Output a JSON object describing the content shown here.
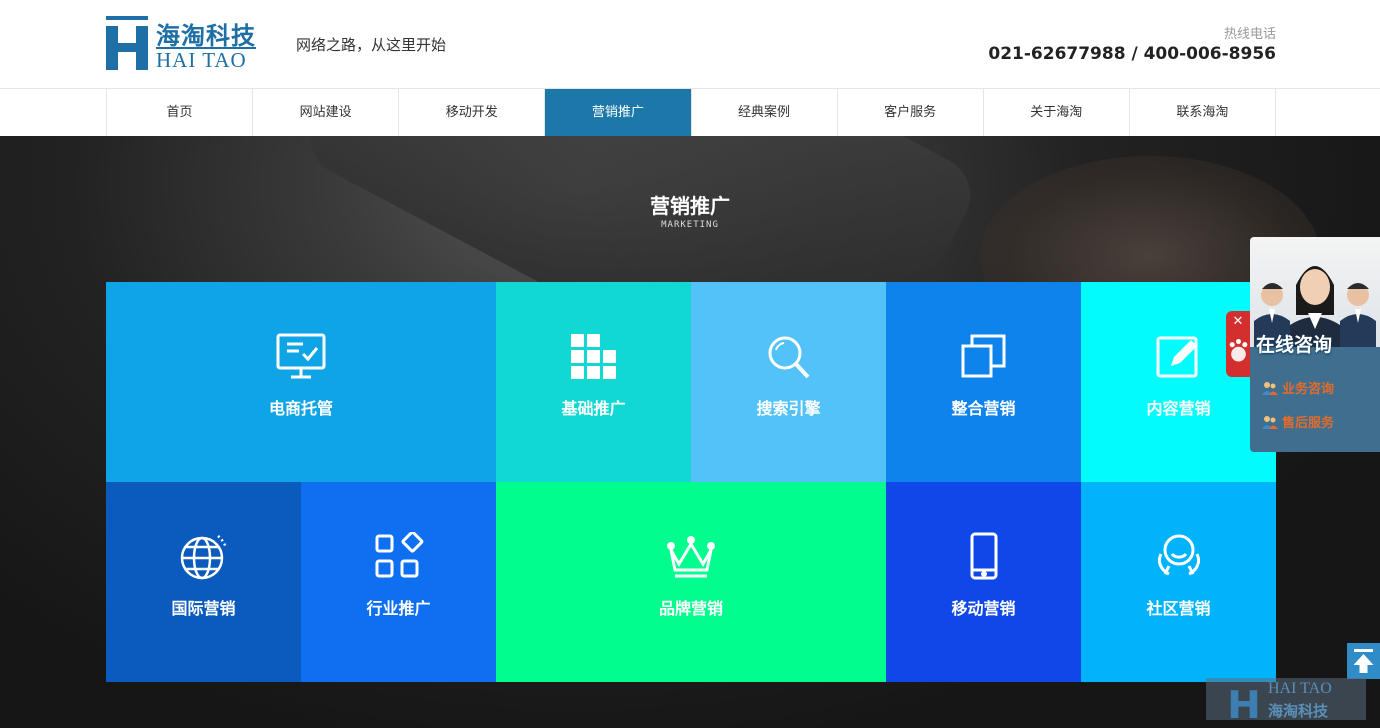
{
  "header": {
    "logo_cn": "海淘科技",
    "logo_en": "HAI TAO",
    "slogan": "网络之路，从这里开始",
    "hotline_label": "热线电话",
    "hotline_number": "021-62677988 / 400-006-8956"
  },
  "nav": {
    "items": [
      "首页",
      "网站建设",
      "移动开发",
      "营销推广",
      "经典案例",
      "客户服务",
      "关于海淘",
      "联系海淘"
    ],
    "active": "营销推广"
  },
  "banner": {
    "title": "营销推广",
    "subtitle": "MARKETING"
  },
  "tiles": [
    {
      "label": "电商托管",
      "icon": "monitor-check-icon",
      "color": "#0fa4e6"
    },
    {
      "label": "基础推广",
      "icon": "grid-blocks-icon",
      "color": "#11d8d3"
    },
    {
      "label": "搜索引擎",
      "icon": "search-icon",
      "color": "#52c2f8"
    },
    {
      "label": "整合营销",
      "icon": "overlap-squares-icon",
      "color": "#0e83ec"
    },
    {
      "label": "内容营销",
      "icon": "edit-icon",
      "color": "#02fbfd"
    },
    {
      "label": "国际营销",
      "icon": "globe-icon",
      "color": "#0a5bbd"
    },
    {
      "label": "行业推广",
      "icon": "apps-icon",
      "color": "#0e6ff0"
    },
    {
      "label": "品牌营销",
      "icon": "crown-icon",
      "color": "#00fd8e"
    },
    {
      "label": "移动营销",
      "icon": "mobile-phone-icon",
      "color": "#1047e8"
    },
    {
      "label": "社区营销",
      "icon": "community-icon",
      "color": "#00b3fb"
    }
  ],
  "consult": {
    "title": "在线咨询",
    "links": [
      "业务咨询",
      "售后服务"
    ]
  },
  "watermark": {
    "en": "HAI TAO",
    "cn": "海淘科技"
  },
  "colors": {
    "brand": "#1d6fa5",
    "nav_active": "#1c78a8"
  }
}
